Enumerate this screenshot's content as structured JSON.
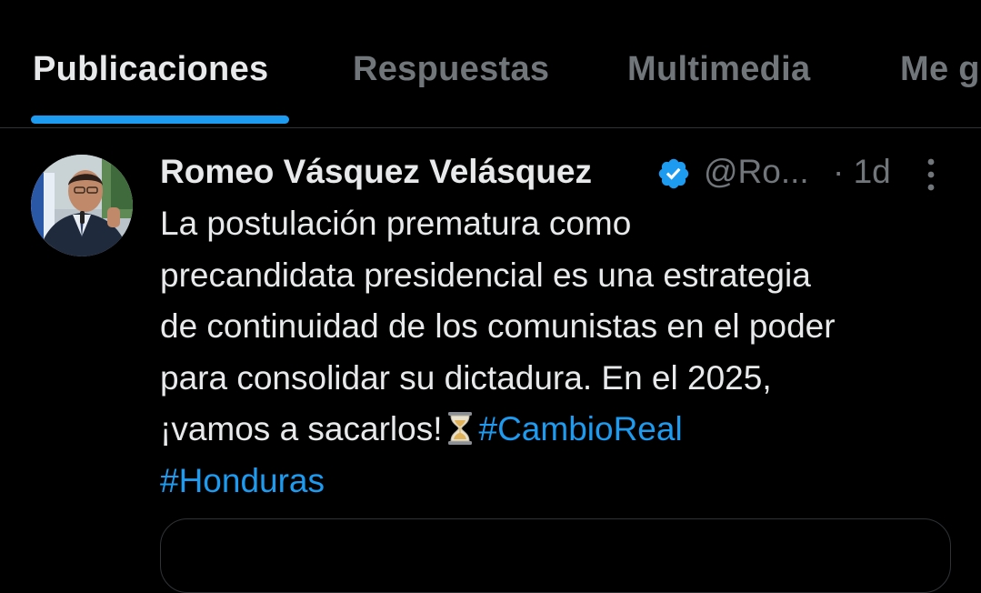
{
  "tabs": [
    {
      "label": "Publicaciones",
      "active": true
    },
    {
      "label": "Respuestas",
      "active": false
    },
    {
      "label": "Multimedia",
      "active": false
    },
    {
      "label": "Me g",
      "active": false
    }
  ],
  "post": {
    "author_name": "Romeo Vásquez Velásquez",
    "verified": true,
    "handle": "@Ro...",
    "time": "· 1d",
    "text_lines": [
      "La postulación prematura como",
      "precandidata presidencial es una estrategia",
      "de continuidad de los comunistas en el poder",
      "para consolidar su dictadura. En el 2025,",
      "¡vamos a sacarlos!"
    ],
    "emoji": "hourglass-icon",
    "hashtags": [
      "#CambioReal",
      "#Honduras"
    ]
  },
  "colors": {
    "background": "#000000",
    "text_primary": "#e7e9ea",
    "text_secondary": "#71767b",
    "accent": "#1d9bf0",
    "divider": "#2f3336"
  },
  "icons": {
    "verified": "verified-badge-icon",
    "more": "more-options-icon",
    "avatar": "profile-avatar"
  }
}
